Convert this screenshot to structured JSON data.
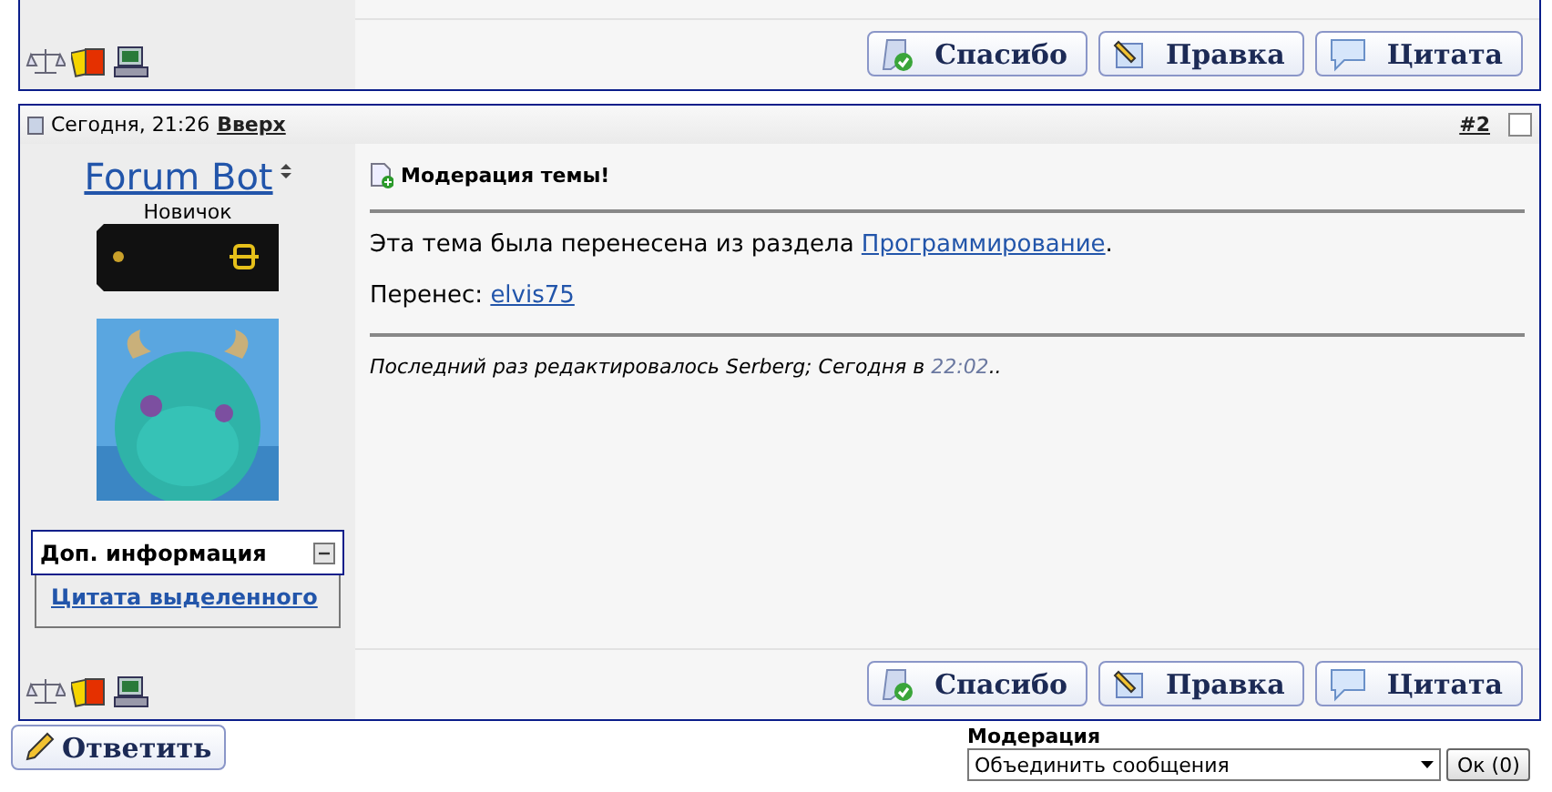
{
  "prev_post": {
    "icons": [
      {
        "kind": "scales"
      },
      {
        "kind": "cards"
      },
      {
        "kind": "computer"
      }
    ],
    "buttons": [
      {
        "kind": "thanks",
        "label": "Спасибо"
      },
      {
        "kind": "edit",
        "label": "Правка"
      },
      {
        "kind": "quote",
        "label": "Цитата"
      }
    ]
  },
  "post": {
    "date": "Сегодня, 21:26",
    "top_link": "Вверх",
    "number": "#2",
    "selected": false,
    "author": "Forum Bot",
    "rank": "Новичок",
    "extra_info": {
      "title": "Доп. информация",
      "expanded": true,
      "links": [
        "Цитата выделенного"
      ]
    },
    "title": "Модерация темы!",
    "body": [
      {
        "before": "Эта тема была перенесена из раздела ",
        "link": "Программирование",
        "after": "."
      },
      {
        "before": "Перенес: ",
        "link": "elvis75"
      }
    ],
    "edit_note": {
      "prefix": "Последний раз редактировалось Serberg; Сегодня в ",
      "time": "22:02",
      "suffix": ".."
    },
    "icons": [
      {
        "kind": "scales"
      },
      {
        "kind": "cards"
      },
      {
        "kind": "computer"
      }
    ],
    "buttons": [
      {
        "kind": "thanks",
        "label": "Спасибо"
      },
      {
        "kind": "edit",
        "label": "Правка"
      },
      {
        "kind": "quote",
        "label": "Цитата"
      }
    ]
  },
  "reply_button": "Ответить",
  "moderation": {
    "label": "Модерация",
    "value": "Объединить сообщения",
    "ok": "Ок (0)"
  }
}
